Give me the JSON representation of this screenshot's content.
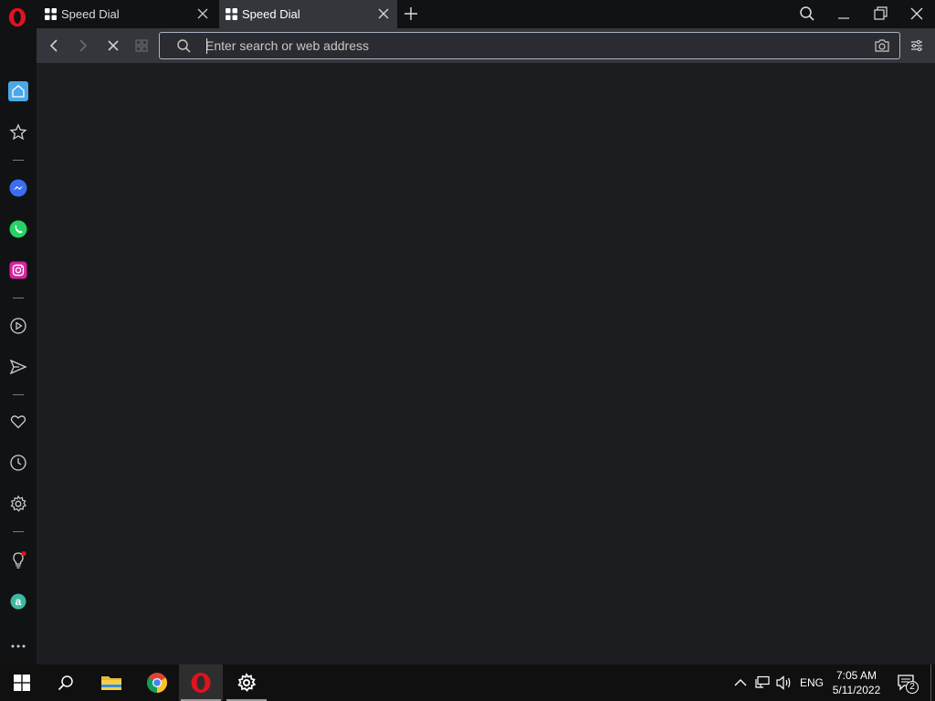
{
  "tabs": [
    {
      "label": "Speed Dial",
      "active": false
    },
    {
      "label": "Speed Dial",
      "active": true
    }
  ],
  "address_bar": {
    "placeholder": "Enter search or web address",
    "value": ""
  },
  "taskbar": {
    "language": "ENG",
    "time": "7:05 AM",
    "date": "5/11/2022",
    "notification_count": "2"
  },
  "colors": {
    "opera_red": "#e1121f",
    "sidebar_home_accent": "#4aa8e8",
    "whatsapp_green": "#25d366",
    "messenger_blue": "#3b6df2",
    "instagram_pink": "#d6249f",
    "aria_green": "#3fb8a3"
  },
  "icons": {
    "sidebar": [
      "home-icon",
      "star-icon",
      "messenger-icon",
      "whatsapp-icon",
      "instagram-icon",
      "player-icon",
      "send-icon",
      "heart-icon",
      "history-icon",
      "settings-icon",
      "lightbulb-icon",
      "aria-icon",
      "more-icon"
    ],
    "taskbar": [
      "windows-start-icon",
      "search-icon",
      "file-explorer-icon",
      "chrome-icon",
      "opera-icon",
      "settings-gear-icon"
    ]
  }
}
